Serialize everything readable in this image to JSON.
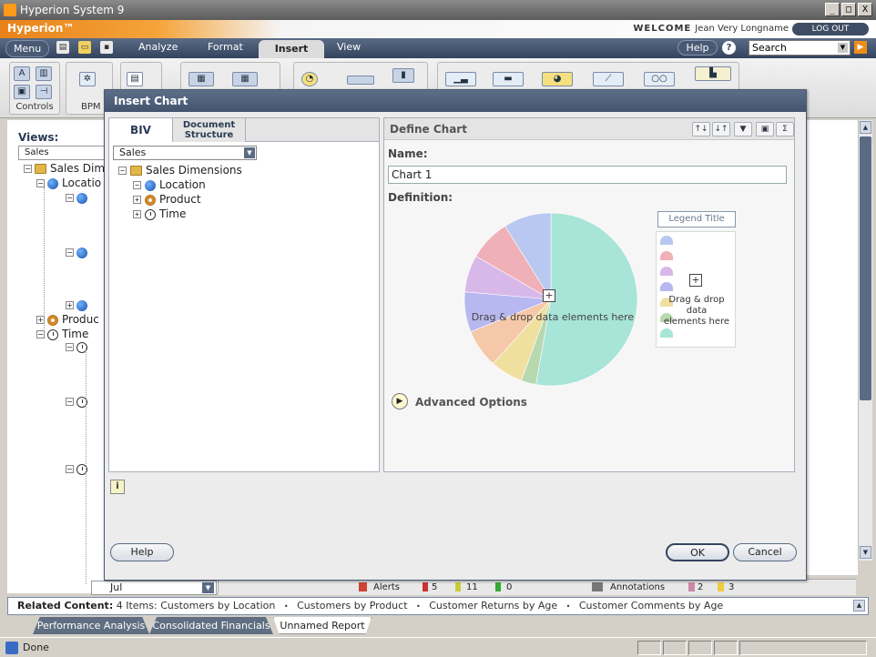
{
  "window": {
    "title": "Hyperion System 9",
    "buttons": [
      "_",
      "□",
      "X"
    ]
  },
  "brand": {
    "name": "Hyperion™",
    "welcome_label": "WELCOME",
    "user": "Jean Very Longname",
    "logout_label": "LOG OUT"
  },
  "menubar": {
    "menu": "Menu",
    "tabs": [
      "Analyze",
      "Format",
      "Insert",
      "View"
    ],
    "help": "Help",
    "help_icon": "?",
    "search": "Search"
  },
  "ribbon": {
    "groups": [
      {
        "label": "Controls"
      },
      {
        "label": "BPM"
      }
    ]
  },
  "workspace": {
    "views_label": "Views:",
    "views_select": "Sales",
    "tree": [
      "Sales Dim",
      "Locatio",
      "Produc",
      "Time"
    ],
    "bottom_select": "Jul"
  },
  "alerts_bar": {
    "alerts_label": "Alerts",
    "red": "5",
    "yellow": "11",
    "green": "0",
    "annotations_label": "Annotations",
    "ann_a": "2",
    "ann_b": "3"
  },
  "related": {
    "label": "Related Content:",
    "text": "4 Items: Customers by Location",
    "items": [
      "Customers by Product",
      "Customer Returns by Age",
      "Customer Comments by Age"
    ],
    "bullet": "•"
  },
  "doc_tabs": [
    "Performance Analysis",
    "Consolidated Financials",
    "Unnamed Report"
  ],
  "status": {
    "text": "Done"
  },
  "dialog": {
    "title": "Insert Chart",
    "biv": {
      "tab_biv": "BIV",
      "tab_doc_line1": "Document",
      "tab_doc_line2": "Structure",
      "select": "Sales",
      "tree": {
        "root": "Sales Dimensions",
        "children": [
          "Location",
          "Product",
          "Time"
        ]
      }
    },
    "define": {
      "header": "Define Chart",
      "name_label": "Name:",
      "name_value": "Chart 1",
      "definition_label": "Definition:",
      "pie_drop_text": "Drag & drop data elements here",
      "legend_title": "Legend Title",
      "legend_drop_line1": "Drag & drop data",
      "legend_drop_line2": "elements here",
      "advanced_label": "Advanced Options",
      "pie_colors": [
        "#a8e4d8",
        "#b8d8b0",
        "#f0e0a0",
        "#f4c8a8",
        "#b8b8f0",
        "#d8b8e8",
        "#f0b0b8",
        "#b8c8f0"
      ],
      "legend_colors": [
        "#b8c8f0",
        "#f0b0b8",
        "#d8b8e8",
        "#b8b8f0",
        "#f0e0a0",
        "#b8d8b0",
        "#a8e4d8"
      ]
    },
    "info_icon": "i",
    "buttons": {
      "help": "Help",
      "ok": "OK",
      "cancel": "Cancel"
    }
  }
}
